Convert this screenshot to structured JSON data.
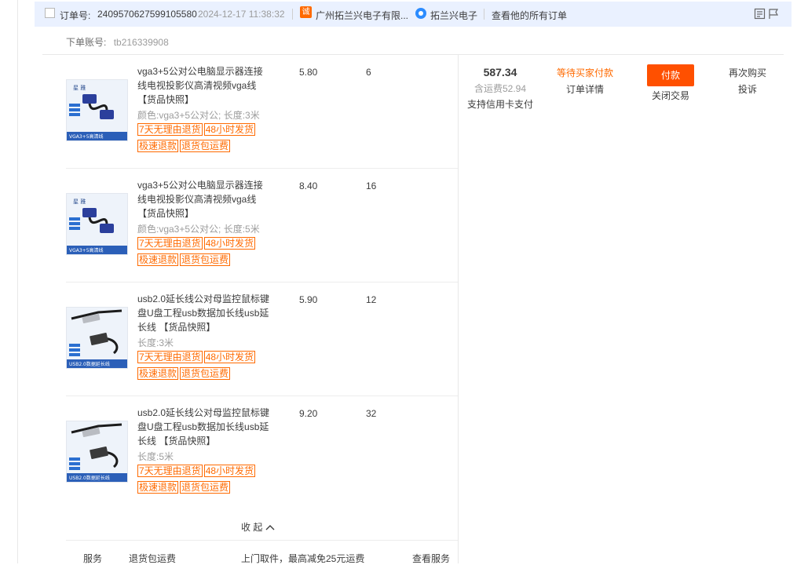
{
  "header": {
    "order_label": "订单号:",
    "order_number": "2409570627599105580",
    "order_time": "2024-12-17 11:38:32",
    "shop_icon": "tmall-shop-icon",
    "shop_icon_text": "诚",
    "shop_name": "广州拓兰兴电子有限...",
    "seller_name": "拓兰兴电子",
    "view_all_orders": "查看他的所有订单"
  },
  "account": {
    "label": "下单账号:",
    "value": "tb216339908"
  },
  "items": [
    {
      "title": "vga3+5公对公电脑显示器连接线电视投影仪高清视频vga线",
      "snapshot": "【货品快照】",
      "attr": "颜色:vga3+5公对公;  长度:3米",
      "tags": [
        "7天无理由退货",
        "48小时发货",
        "极速退款",
        "退货包运费"
      ],
      "price": "5.80",
      "qty": "6",
      "thumb_label": "VGA3+5高清线"
    },
    {
      "title": "vga3+5公对公电脑显示器连接线电视投影仪高清视频vga线",
      "snapshot": "【货品快照】",
      "attr": "颜色:vga3+5公对公;  长度:5米",
      "tags": [
        "7天无理由退货",
        "48小时发货",
        "极速退款",
        "退货包运费"
      ],
      "price": "8.40",
      "qty": "16",
      "thumb_label": "VGA3+5高清线"
    },
    {
      "title": "usb2.0延长线公对母监控鼠标键盘U盘工程usb数据加长线usb延长线",
      "snapshot": "【货品快照】",
      "attr": "长度:3米",
      "tags": [
        "7天无理由退货",
        "48小时发货",
        "极速退款",
        "退货包运费"
      ],
      "price": "5.90",
      "qty": "12",
      "thumb_label": "USB2.0数据延长线"
    },
    {
      "title": "usb2.0延长线公对母监控鼠标键盘U盘工程usb数据加长线usb延长线",
      "snapshot": "【货品快照】",
      "attr": "长度:5米",
      "tags": [
        "7天无理由退货",
        "48小时发货",
        "极速退款",
        "退货包运费"
      ],
      "price": "9.20",
      "qty": "32",
      "thumb_label": "USB2.0数据延长线"
    }
  ],
  "collapse": {
    "label": "收  起",
    "arrow": "chevron-up-icon"
  },
  "service": {
    "label": "服务",
    "name": "退货包运费",
    "desc": "上门取件，最高减免25元运费",
    "link": "查看服务"
  },
  "total": {
    "amount": "587.34",
    "shipping": "含运费52.94",
    "payment_note": "支持信用卡支付"
  },
  "status": {
    "text": "等待买家付款",
    "detail_link": "订单详情"
  },
  "actions": {
    "pay_button": "付款",
    "close_link": "关闭交易",
    "rebuy_link": "再次购买",
    "complain_link": "投诉"
  },
  "colors": {
    "accent_orange": "#ff6a00",
    "pay_button_bg": "#ff5000",
    "header_bg": "#eaf1ff"
  }
}
